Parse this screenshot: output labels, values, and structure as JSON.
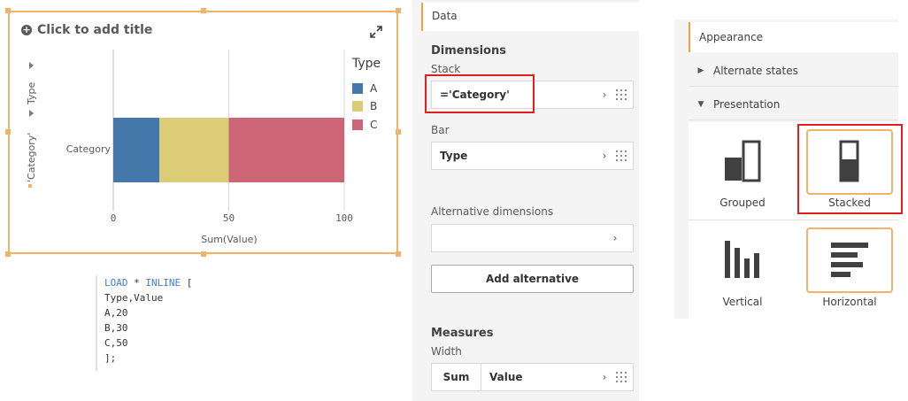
{
  "chart": {
    "title": "Click to add title",
    "side_dim_1": "'Category'",
    "side_dim_2": "Type",
    "category_label": "Category",
    "xlabel": "Sum(Value)",
    "ticks": [
      "0",
      "50",
      "100"
    ],
    "legend_title": "Type",
    "legend_items": [
      "A",
      "B",
      "C"
    ]
  },
  "chart_data": {
    "type": "bar",
    "orientation": "horizontal",
    "stacked": true,
    "categories": [
      "Category"
    ],
    "series": [
      {
        "name": "A",
        "values": [
          20
        ],
        "color": "#4477aa"
      },
      {
        "name": "B",
        "values": [
          30
        ],
        "color": "#ddcc77"
      },
      {
        "name": "C",
        "values": [
          50
        ],
        "color": "#cc6677"
      }
    ],
    "xlabel": "Sum(Value)",
    "xlim": [
      0,
      100
    ],
    "xticks": [
      0,
      50,
      100
    ],
    "legend_title": "Type",
    "legend_position": "right",
    "grid": true
  },
  "script": {
    "kw_load": "LOAD",
    "star": " * ",
    "kw_inline": "INLINE",
    "open": " [",
    "lines": [
      "Type,Value",
      "A,20",
      "B,30",
      "C,50",
      "];"
    ]
  },
  "data_panel": {
    "tab": "Data",
    "dimensions_title": "Dimensions",
    "stack_label": "Stack",
    "stack_value": "='Category'",
    "bar_label": "Bar",
    "bar_value": "Type",
    "alt_dims_label": "Alternative dimensions",
    "add_alternative": "Add alternative",
    "measures_title": "Measures",
    "width_label": "Width",
    "measure_agg": "Sum",
    "measure_field": "Value"
  },
  "appearance": {
    "tab": "Appearance",
    "alternate_states": "Alternate states",
    "presentation": "Presentation",
    "grouped": "Grouped",
    "stacked": "Stacked",
    "vertical": "Vertical",
    "horizontal": "Horizontal"
  },
  "colors": {
    "accent": "#f0b36a",
    "highlight": "#e02020",
    "icon": "#404040"
  }
}
